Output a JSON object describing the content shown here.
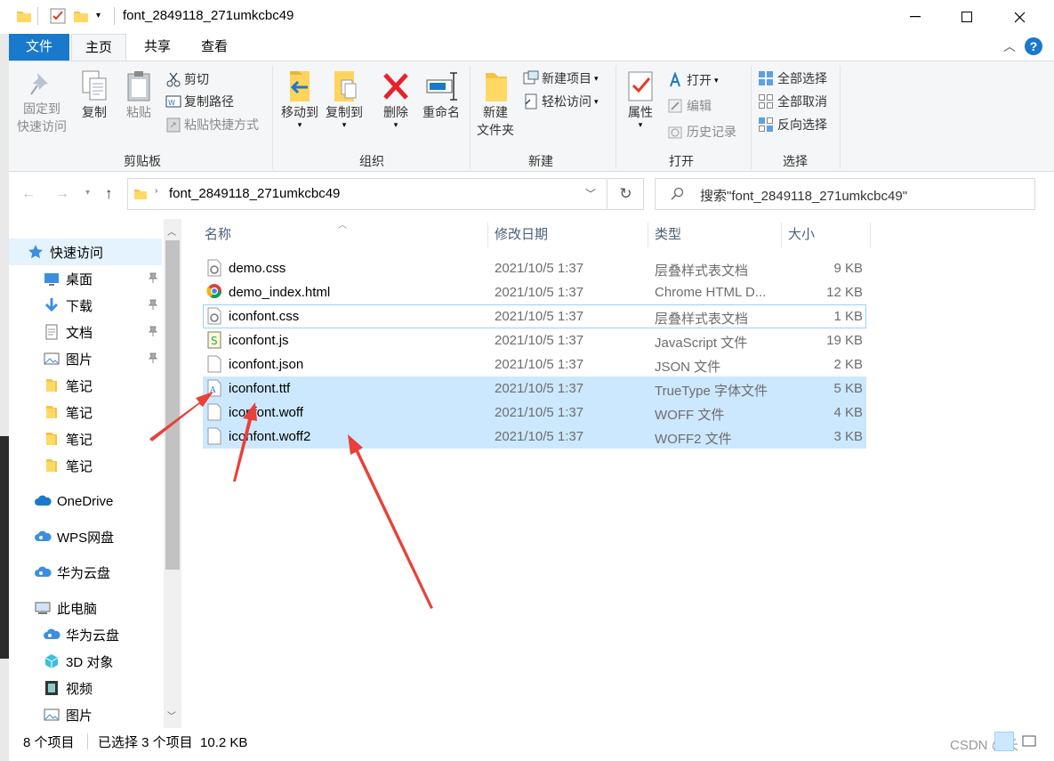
{
  "window": {
    "title": "font_2849118_271umkcbc49"
  },
  "tabs": [
    {
      "label": "文件"
    },
    {
      "label": "主页"
    },
    {
      "label": "共享"
    },
    {
      "label": "查看"
    }
  ],
  "ribbon": {
    "clipboard": {
      "pin": "固定到\n快速访问",
      "copy": "复制",
      "paste": "粘贴",
      "cut": "剪切",
      "copy_path": "复制路径",
      "paste_shortcut": "粘贴快捷方式",
      "group": "剪贴板"
    },
    "organize": {
      "move_to": "移动到",
      "copy_to": "复制到",
      "delete": "删除",
      "rename": "重命名",
      "group": "组织"
    },
    "new": {
      "new_folder": "新建\n文件夹",
      "new_item": "新建项目",
      "easy_access": "轻松访问",
      "group": "新建"
    },
    "open": {
      "properties": "属性",
      "open": "打开",
      "edit": "编辑",
      "history": "历史记录",
      "group": "打开"
    },
    "select": {
      "select_all": "全部选择",
      "select_none": "全部取消",
      "invert": "反向选择",
      "group": "选择"
    }
  },
  "address": {
    "path": "font_2849118_271umkcbc49",
    "search_placeholder": "搜索\"font_2849118_271umkcbc49\""
  },
  "nav": {
    "items": [
      {
        "label": "快速访问"
      },
      {
        "label": "桌面"
      },
      {
        "label": "下载"
      },
      {
        "label": "文档"
      },
      {
        "label": "图片"
      },
      {
        "label": "笔记"
      },
      {
        "label": "笔记"
      },
      {
        "label": "笔记"
      },
      {
        "label": "笔记"
      },
      {
        "label": "OneDrive"
      },
      {
        "label": "WPS网盘"
      },
      {
        "label": "华为云盘"
      },
      {
        "label": "此电脑"
      },
      {
        "label": "华为云盘"
      },
      {
        "label": "3D 对象"
      },
      {
        "label": "视频"
      },
      {
        "label": "图片"
      }
    ]
  },
  "columns": {
    "name": "名称",
    "date": "修改日期",
    "type": "类型",
    "size": "大小"
  },
  "files": [
    {
      "name": "demo.css",
      "date": "2021/10/5 1:37",
      "type": "层叠样式表文档",
      "size": "9 KB"
    },
    {
      "name": "demo_index.html",
      "date": "2021/10/5 1:37",
      "type": "Chrome HTML D...",
      "size": "12 KB"
    },
    {
      "name": "iconfont.css",
      "date": "2021/10/5 1:37",
      "type": "层叠样式表文档",
      "size": "1 KB"
    },
    {
      "name": "iconfont.js",
      "date": "2021/10/5 1:37",
      "type": "JavaScript 文件",
      "size": "19 KB"
    },
    {
      "name": "iconfont.json",
      "date": "2021/10/5 1:37",
      "type": "JSON 文件",
      "size": "2 KB"
    },
    {
      "name": "iconfont.ttf",
      "date": "2021/10/5 1:37",
      "type": "TrueType 字体文件",
      "size": "5 KB"
    },
    {
      "name": "iconfont.woff",
      "date": "2021/10/5 1:37",
      "type": "WOFF 文件",
      "size": "4 KB"
    },
    {
      "name": "iconfont.woff2",
      "date": "2021/10/5 1:37",
      "type": "WOFF2 文件",
      "size": "3 KB"
    }
  ],
  "status": {
    "count": "8 个项目",
    "selected": "已选择 3 个项目  10.2 KB"
  },
  "watermark": "CSDN @长",
  "colors": {
    "accent": "#1979ca",
    "selection": "#cce8ff",
    "arrow": "#e8413a"
  }
}
